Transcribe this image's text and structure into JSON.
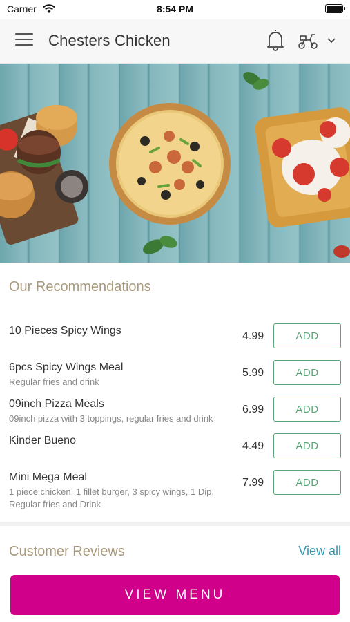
{
  "status_bar": {
    "carrier": "Carrier",
    "time": "8:54 PM",
    "icons": [
      "wifi-icon",
      "battery-icon"
    ]
  },
  "header": {
    "title": "Chesters Chicken",
    "icons": [
      "menu-icon",
      "bell-icon",
      "scooter-icon",
      "chevron-down-icon"
    ]
  },
  "hero": {
    "description_icons": [
      "burger",
      "pizza",
      "waffle"
    ]
  },
  "recommendations": {
    "title": "Our Recommendations",
    "add_label": "ADD",
    "items": [
      {
        "name": "10 Pieces Spicy Wings",
        "description": "",
        "price": "4.99"
      },
      {
        "name": "6pcs Spicy Wings Meal",
        "description": "Regular fries and drink",
        "price": "5.99"
      },
      {
        "name": "09inch Pizza Meals",
        "description": "09inch pizza with 3 toppings, regular fries and drink",
        "price": "6.99"
      },
      {
        "name": "Kinder Bueno",
        "description": "",
        "price": "4.49"
      },
      {
        "name": "Mini Mega Meal",
        "description": "1 piece chicken, 1 fillet burger, 3 spicy wings, 1 Dip, Regular fries and Drink",
        "price": "7.99"
      }
    ]
  },
  "reviews": {
    "title": "Customer Reviews",
    "view_all": "View all"
  },
  "footer": {
    "view_menu_label": "VIEW MENU"
  },
  "colors": {
    "accent_magenta": "#d1008b",
    "add_green": "#5aa677",
    "section_title": "#a99a7d",
    "link_blue": "#2c9ab3"
  }
}
